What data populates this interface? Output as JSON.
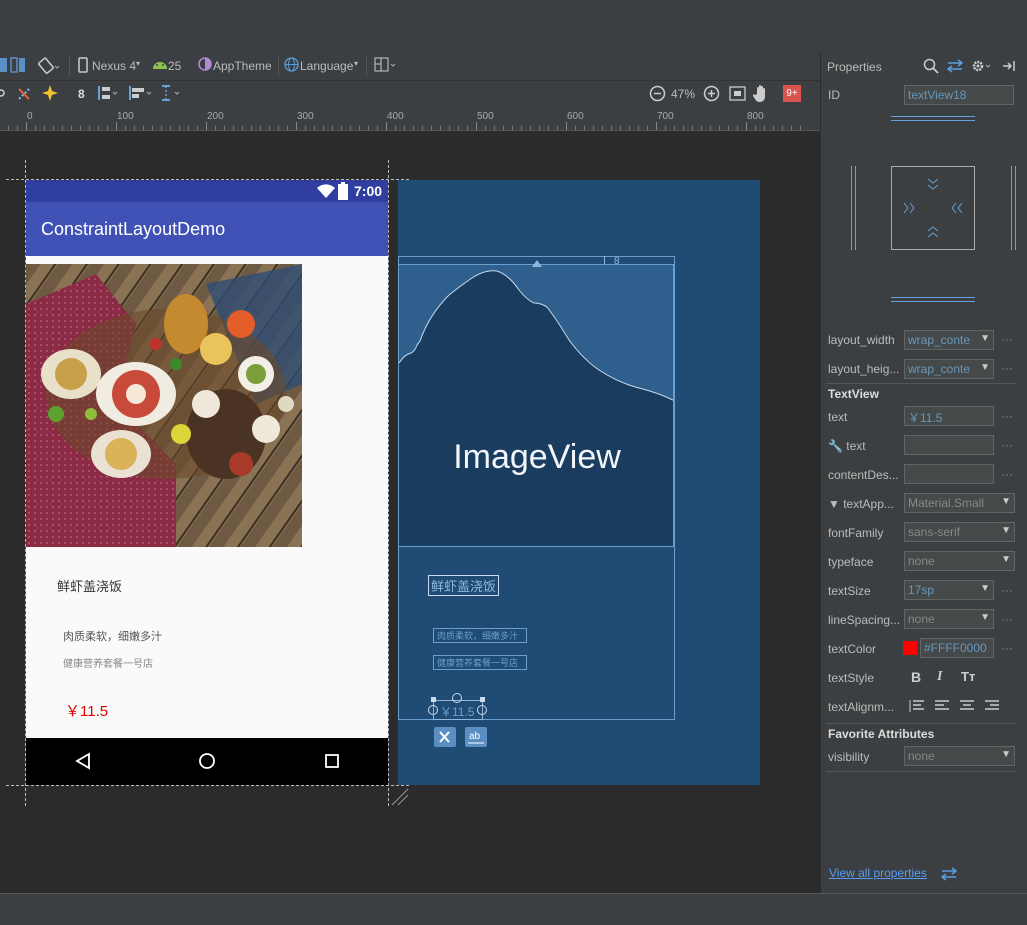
{
  "toolbar": {
    "device": "Nexus 4",
    "api": "25",
    "theme": "AppTheme",
    "language": "Language",
    "margin_value": "8",
    "zoom": "47%",
    "notifications": "9+"
  },
  "ruler": {
    "labels": [
      "0",
      "100",
      "200",
      "300",
      "400",
      "500",
      "600",
      "700",
      "800"
    ]
  },
  "phone": {
    "time": "7:00",
    "app_title": "ConstraintLayoutDemo",
    "dish_title": "鲜虾盖浇饭",
    "description": "肉质柔软，细嫩多汁",
    "store": "健康营养套餐一号店",
    "price": "￥11.5"
  },
  "blueprint": {
    "image_label": "ImageView",
    "dish_title": "鲜虾盖浇饭",
    "description": "肉质柔软，细嫩多汁",
    "store": "健康营养套餐一号店",
    "price": "￥11.5",
    "margin_label": "8"
  },
  "properties": {
    "title": "Properties",
    "id_label": "ID",
    "id_value": "textView18",
    "layout_width_label": "layout_width",
    "layout_width_value": "wrap_conte",
    "layout_height_label": "layout_heig...",
    "layout_height_value": "wrap_conte",
    "section_textview": "TextView",
    "text_label": "text",
    "text_value": "￥11.5",
    "tools_text_label": "text",
    "content_desc_label": "contentDes...",
    "text_appearance_label": "▼ textApp...",
    "text_appearance_value": "Material.Small",
    "font_family_label": "fontFamily",
    "font_family_value": "sans-serif",
    "typeface_label": "typeface",
    "typeface_value": "none",
    "text_size_label": "textSize",
    "text_size_value": "17sp",
    "line_spacing_label": "lineSpacing...",
    "line_spacing_value": "none",
    "text_color_label": "textColor",
    "text_color_value": "#FFFF0000",
    "text_style_label": "textStyle",
    "text_alignment_label": "textAlignm...",
    "section_favorites": "Favorite Attributes",
    "visibility_label": "visibility",
    "visibility_value": "none",
    "view_all": "View all properties"
  },
  "colors": {
    "app_bar": "#3f51b5",
    "status_bar": "#303f9f",
    "blueprint": "#1f4b75",
    "price": "#e00000",
    "text_color_swatch": "#ff0000",
    "link": "#589df6"
  },
  "icons": [
    "design-mode-icon",
    "blueprint-mode-icon",
    "orientation-icon",
    "phone-icon",
    "android-icon",
    "theme-icon",
    "globe-icon",
    "layout-variants-icon",
    "clear-constraints-icon",
    "infer-constraints-icon",
    "margin-icon",
    "pack-icon",
    "align-icon",
    "guidelines-icon",
    "zoom-out-icon",
    "zoom-in-icon",
    "zoom-fit-icon",
    "pan-icon",
    "search-icon",
    "swap-icon",
    "gear-icon",
    "pin-icon",
    "wifi-icon",
    "battery-icon",
    "back-icon",
    "home-icon",
    "recents-icon"
  ]
}
